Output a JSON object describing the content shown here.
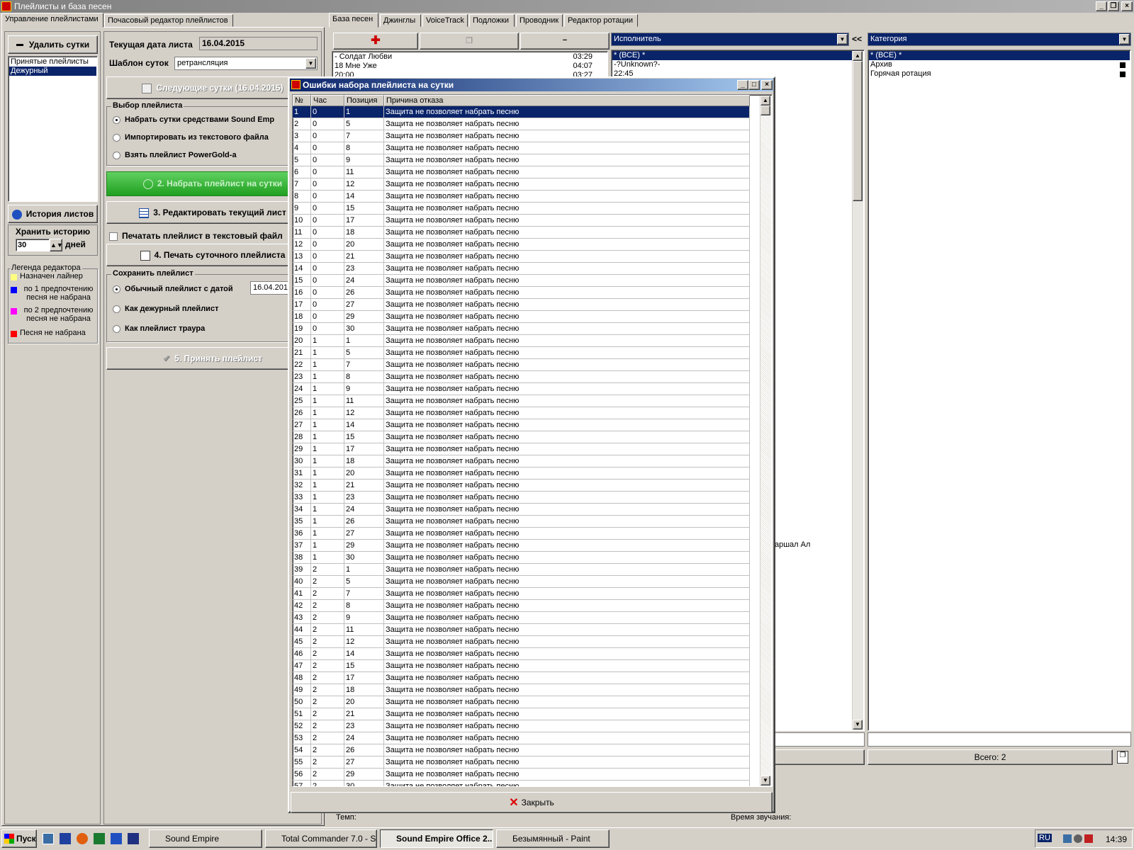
{
  "window": {
    "title": "Плейлисты и база песен"
  },
  "left_tabs": [
    "Управление плейлистами",
    "Почасовый редактор плейлистов"
  ],
  "sidebar": {
    "delete_day": "Удалить сутки",
    "lists": [
      {
        "label": "Принятые плейлисты"
      },
      {
        "label": "Дежурный"
      }
    ],
    "history_btn": "История листов",
    "keep_history": "Хранить историю",
    "days_value": "30",
    "days_label": "дней",
    "legend_title": "Легенда редактора",
    "legend": [
      {
        "label": "Назначен лайнер",
        "color": "#ffff80"
      },
      {
        "label": "по 1 предпочтению песня не набрана",
        "color": "#0000ff"
      },
      {
        "label": "по 2 предпочтению песня не набрана",
        "color": "#ff00ff"
      },
      {
        "label": "Песня не набрана",
        "color": "#ff0000"
      }
    ]
  },
  "form": {
    "date_label": "Текущая дата листа",
    "date_value": "16.04.2015",
    "template_label": "Шаблон суток",
    "template_value": "ретрансляция",
    "next_day_btn": "Следующие сутки (16.04.2015)",
    "choose_title": "Выбор плейлиста",
    "choose_opts": [
      "Набрать сутки средствами Sound Emp",
      "Импортировать из текстового файла",
      "Взять плейлист PowerGold-а"
    ],
    "btn2": "2. Набрать плейлист на сутки",
    "btn3": "3. Редактировать текущий лист",
    "print_chk": "Печатать плейлист в текстовый файл",
    "btn4": "4. Печать суточного плейлиста",
    "save_title": "Сохранить плейлист",
    "save_opts": [
      "Обычный плейлист с датой",
      "Как дежурный плейлист",
      "Как плейлист траура"
    ],
    "save_date": "16.04.201",
    "btn5": "5. Принять плейлист"
  },
  "right_tabs": [
    "База песен",
    "Джинглы",
    "VoiceTrack",
    "Подложки",
    "Проводник",
    "Редактор ротации"
  ],
  "songs": [
    {
      "title": "- Солдат Любви",
      "dur": "03:29"
    },
    {
      "title": "18 Мне Уже",
      "dur": "04:07"
    },
    {
      "title": "20:00",
      "dur": "03:27"
    }
  ],
  "artist_combo": "Исполнитель",
  "artist_list": [
    "* (ВСЕ) *",
    "-?Unknown?-",
    "22:45"
  ],
  "artist_partial": "аршал Ал",
  "collapse_btn": "<<",
  "category_combo": "Категория",
  "category_list": [
    "* (ВСЕ) *",
    "Архив",
    "Горячая ротация"
  ],
  "total": "Всего: 2",
  "tempo_label": "Темп:",
  "duration_label": "Время звучания:",
  "dialog": {
    "title": "Ошибки набора плейлиста на сутки",
    "columns": [
      "№№",
      "Час",
      "Позиция",
      "Причина отказа"
    ],
    "reason": "Защита не позволяет набрать песню",
    "rows": [
      [
        1,
        0,
        1
      ],
      [
        2,
        0,
        5
      ],
      [
        3,
        0,
        7
      ],
      [
        4,
        0,
        8
      ],
      [
        5,
        0,
        9
      ],
      [
        6,
        0,
        11
      ],
      [
        7,
        0,
        12
      ],
      [
        8,
        0,
        14
      ],
      [
        9,
        0,
        15
      ],
      [
        10,
        0,
        17
      ],
      [
        11,
        0,
        18
      ],
      [
        12,
        0,
        20
      ],
      [
        13,
        0,
        21
      ],
      [
        14,
        0,
        23
      ],
      [
        15,
        0,
        24
      ],
      [
        16,
        0,
        26
      ],
      [
        17,
        0,
        27
      ],
      [
        18,
        0,
        29
      ],
      [
        19,
        0,
        30
      ],
      [
        20,
        1,
        1
      ],
      [
        21,
        1,
        5
      ],
      [
        22,
        1,
        7
      ],
      [
        23,
        1,
        8
      ],
      [
        24,
        1,
        9
      ],
      [
        25,
        1,
        11
      ],
      [
        26,
        1,
        12
      ],
      [
        27,
        1,
        14
      ],
      [
        28,
        1,
        15
      ],
      [
        29,
        1,
        17
      ],
      [
        30,
        1,
        18
      ],
      [
        31,
        1,
        20
      ],
      [
        32,
        1,
        21
      ],
      [
        33,
        1,
        23
      ],
      [
        34,
        1,
        24
      ],
      [
        35,
        1,
        26
      ],
      [
        36,
        1,
        27
      ],
      [
        37,
        1,
        29
      ],
      [
        38,
        1,
        30
      ],
      [
        39,
        2,
        1
      ],
      [
        40,
        2,
        5
      ],
      [
        41,
        2,
        7
      ],
      [
        42,
        2,
        8
      ],
      [
        43,
        2,
        9
      ],
      [
        44,
        2,
        11
      ],
      [
        45,
        2,
        12
      ],
      [
        46,
        2,
        14
      ],
      [
        47,
        2,
        15
      ],
      [
        48,
        2,
        17
      ],
      [
        49,
        2,
        18
      ],
      [
        50,
        2,
        20
      ],
      [
        51,
        2,
        21
      ],
      [
        52,
        2,
        23
      ],
      [
        53,
        2,
        24
      ],
      [
        54,
        2,
        26
      ],
      [
        55,
        2,
        27
      ],
      [
        56,
        2,
        29
      ],
      [
        57,
        2,
        30
      ]
    ],
    "close_btn": "Закрыть"
  },
  "taskbar": {
    "start": "Пуск",
    "tasks": [
      "Sound Empire",
      "Total Commander 7.0 - S...",
      "Sound Empire Office 2...",
      "Безымянный - Paint"
    ],
    "lang": "RU",
    "time": "14:39"
  }
}
